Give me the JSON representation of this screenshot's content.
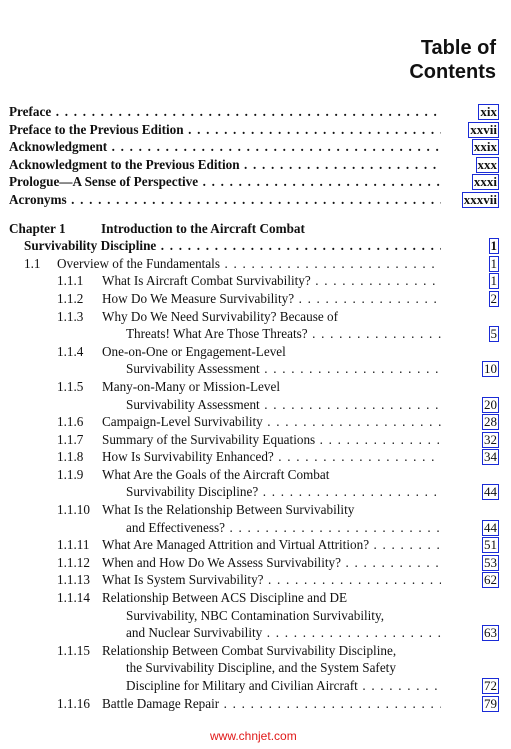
{
  "header": {
    "title_line1": "Table of",
    "title_line2": "Contents"
  },
  "front_matter": [
    {
      "title": "Preface",
      "page": "xix"
    },
    {
      "title": "Preface to the Previous Edition",
      "page": "xxvii"
    },
    {
      "title": "Acknowledgment",
      "page": "xxix"
    },
    {
      "title": "Acknowledgment to the Previous Edition",
      "page": "xxx"
    },
    {
      "title": "Prologue—A Sense of Perspective",
      "page": "xxxi"
    },
    {
      "title": "Acronyms",
      "page": "xxxvii"
    }
  ],
  "chapter": {
    "number": "Chapter 1",
    "title_line1": "Introduction to the Aircraft Combat",
    "title_line2": "Survivability Discipline",
    "page": "1"
  },
  "section": {
    "number": "1.1",
    "title": "Overview of the Fundamentals",
    "page": "1"
  },
  "subsections": [
    {
      "number": "1.1.1",
      "lines": [
        "What Is Aircraft Combat Survivability?"
      ],
      "page": "1"
    },
    {
      "number": "1.1.2",
      "lines": [
        "How Do We Measure Survivability?"
      ],
      "page": "2"
    },
    {
      "number": "1.1.3",
      "lines": [
        "Why Do We Need Survivability? Because of",
        "Threats! What Are Those Threats?"
      ],
      "page": "5"
    },
    {
      "number": "1.1.4",
      "lines": [
        "One-on-One or Engagement-Level",
        "Survivability Assessment"
      ],
      "page": "10"
    },
    {
      "number": "1.1.5",
      "lines": [
        "Many-on-Many or Mission-Level",
        "Survivability Assessment"
      ],
      "page": "20"
    },
    {
      "number": "1.1.6",
      "lines": [
        "Campaign-Level Survivability"
      ],
      "page": "28"
    },
    {
      "number": "1.1.7",
      "lines": [
        "Summary of the Survivability Equations"
      ],
      "page": "32"
    },
    {
      "number": "1.1.8",
      "lines": [
        "How Is Survivability Enhanced?"
      ],
      "page": "34"
    },
    {
      "number": "1.1.9",
      "lines": [
        "What Are the Goals of the Aircraft Combat",
        "Survivability Discipline?"
      ],
      "page": "44"
    },
    {
      "number": "1.1.10",
      "lines": [
        "What Is the Relationship Between Survivability",
        "and Effectiveness?"
      ],
      "page": "44"
    },
    {
      "number": "1.1.11",
      "lines": [
        "What Are Managed Attrition and Virtual Attrition?"
      ],
      "page": "51"
    },
    {
      "number": "1.1.12",
      "lines": [
        "When and How Do We Assess Survivability?"
      ],
      "page": "53"
    },
    {
      "number": "1.1.13",
      "lines": [
        "What Is System Survivability?"
      ],
      "page": "62"
    },
    {
      "number": "1.1.14",
      "lines": [
        "Relationship Between ACS Discipline and DE",
        "Survivability, NBC Contamination Survivability,",
        "and Nuclear Survivability"
      ],
      "page": "63"
    },
    {
      "number": "1.1.15",
      "lines": [
        "Relationship Between Combat Survivability Discipline,",
        "the Survivability Discipline, and the System Safety",
        "Discipline for Military and Civilian Aircraft"
      ],
      "page": "72"
    },
    {
      "number": "1.1.16",
      "lines": [
        "Battle Damage Repair"
      ],
      "page": "79"
    }
  ],
  "watermark": "www.chnjet.com"
}
